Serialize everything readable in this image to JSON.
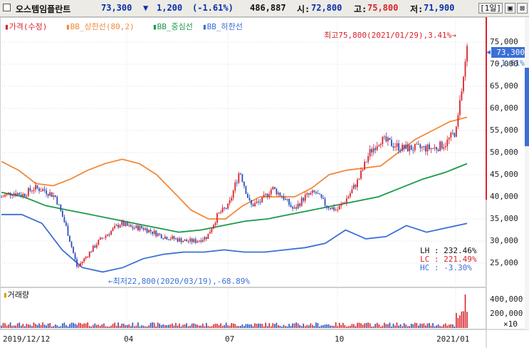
{
  "header": {
    "name": "오스템임플란트",
    "price": "73,300",
    "change_arrow": "▼",
    "change": "1,200",
    "change_pct": "(-1.61%)",
    "volume": "486,887",
    "open_label": "시:",
    "open": "72,800",
    "high_label": "고:",
    "high": "75,800",
    "low_label": "저:",
    "low": "71,900",
    "period_button": "[1일]",
    "restore_icon": "restore-icon",
    "close_icon": "close-icon"
  },
  "legend": [
    {
      "label": "가격(수정)",
      "color": "#d8232a"
    },
    {
      "label": "BB_상한선(80,2)",
      "color": "#f08a3c"
    },
    {
      "label": "BB_중심선",
      "color": "#1a9a4a"
    },
    {
      "label": "BB_하한선",
      "color": "#3a6fd6"
    }
  ],
  "annotations": {
    "high": "최고75,800(2021/01/29),3.41%→",
    "low": "←최저22,800(2020/03/19),-68.89%",
    "lh": "LH : 232.46%",
    "lc": "LC : 221.49%",
    "hc": "HC : -3.30%"
  },
  "price_box": {
    "price": "73,300",
    "pct": "-1.61%"
  },
  "volume_panel": {
    "label": "거래량",
    "unit": "×10"
  },
  "chart_data": {
    "type": "line",
    "x": [
      "2019/12/12",
      "04",
      "07",
      "10",
      "2021/01"
    ],
    "price_axis": {
      "ticks": [
        "75,000",
        "70,000",
        "65,000",
        "60,000",
        "55,000",
        "50,000",
        "45,000",
        "40,000",
        "35,000",
        "30,000",
        "25,000"
      ],
      "ylim": [
        20000,
        80000
      ]
    },
    "volume_axis": {
      "ticks": [
        "400,000",
        "200,000"
      ],
      "ylim": [
        0,
        500000
      ]
    },
    "series": [
      {
        "name": "가격(수정)",
        "values": [
          40000,
          41000,
          40500,
          42000,
          41500,
          40000,
          33000,
          24000,
          27000,
          30000,
          32000,
          34000,
          33000,
          33000,
          32000,
          31000,
          30500,
          30000,
          30000,
          31000,
          36000,
          38000,
          46000,
          38000,
          39000,
          42000,
          40000,
          37000,
          40000,
          41000,
          38000,
          37000,
          40000,
          44000,
          50000,
          53000,
          52000,
          51000,
          51000,
          51000,
          51000,
          52000,
          55000,
          73300
        ]
      },
      {
        "name": "BB_상한선(80,2)",
        "values": [
          48000,
          46000,
          43000,
          42500,
          44000,
          46000,
          47500,
          48500,
          47500,
          45000,
          41000,
          37000,
          35000,
          35000,
          38000,
          40000,
          40000,
          40000,
          42000,
          45000,
          46000,
          46500,
          47000,
          50000,
          53000,
          55000,
          57000,
          58000
        ]
      },
      {
        "name": "BB_중심선",
        "values": [
          41000,
          40000,
          38000,
          37000,
          36000,
          35000,
          34000,
          33000,
          32000,
          32500,
          33500,
          34500,
          35000,
          36000,
          37000,
          38000,
          39000,
          40000,
          42000,
          44000,
          45500,
          47500
        ]
      },
      {
        "name": "BB_하한선",
        "values": [
          36000,
          36000,
          34000,
          28000,
          24000,
          23000,
          24000,
          26000,
          27000,
          27500,
          27500,
          28000,
          27500,
          27500,
          28000,
          28500,
          29500,
          32500,
          30500,
          31000,
          33500,
          32000,
          33000,
          34000
        ]
      }
    ]
  }
}
